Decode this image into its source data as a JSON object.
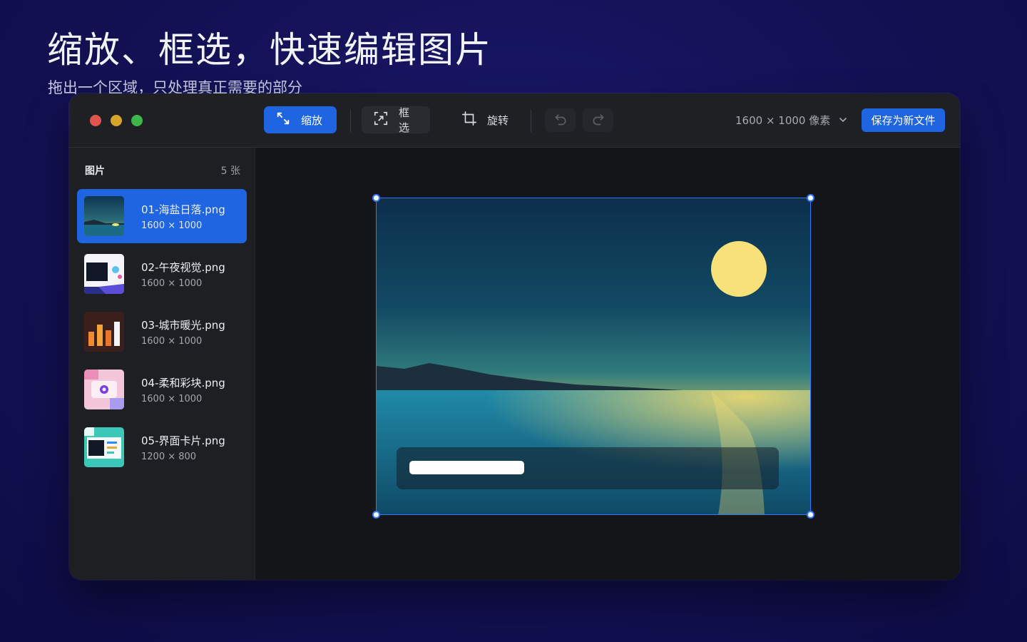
{
  "hero": {
    "title": "缩放、框选，快速编辑图片",
    "subtitle": "拖出一个区域，只处理真正需要的部分"
  },
  "toolbar": {
    "zoom_label": "缩放",
    "select_label": "框选",
    "rotate_label": "旋转",
    "size_label": "1600 × 1000 像素",
    "save_label": "保存为新文件",
    "icons": [
      "expand-icon",
      "select-area-icon",
      "crop-rotate-icon",
      "undo-icon",
      "redo-icon",
      "chevron-down-icon"
    ]
  },
  "sidebar": {
    "title": "图片",
    "count": "5 张",
    "items": [
      {
        "name": "01-海盐日落.png",
        "dims": "1600 × 1000",
        "active": true
      },
      {
        "name": "02-午夜视觉.png",
        "dims": "1600 × 1000",
        "active": false
      },
      {
        "name": "03-城市暖光.png",
        "dims": "1600 × 1000",
        "active": false
      },
      {
        "name": "04-柔和彩块.png",
        "dims": "1600 × 1000",
        "active": false
      },
      {
        "name": "05-界面卡片.png",
        "dims": "1200 × 800",
        "active": false
      }
    ]
  },
  "colors": {
    "accent": "#1f64e0",
    "selection": "#2f78ff",
    "background": "#15135a",
    "window": "#17181c"
  }
}
